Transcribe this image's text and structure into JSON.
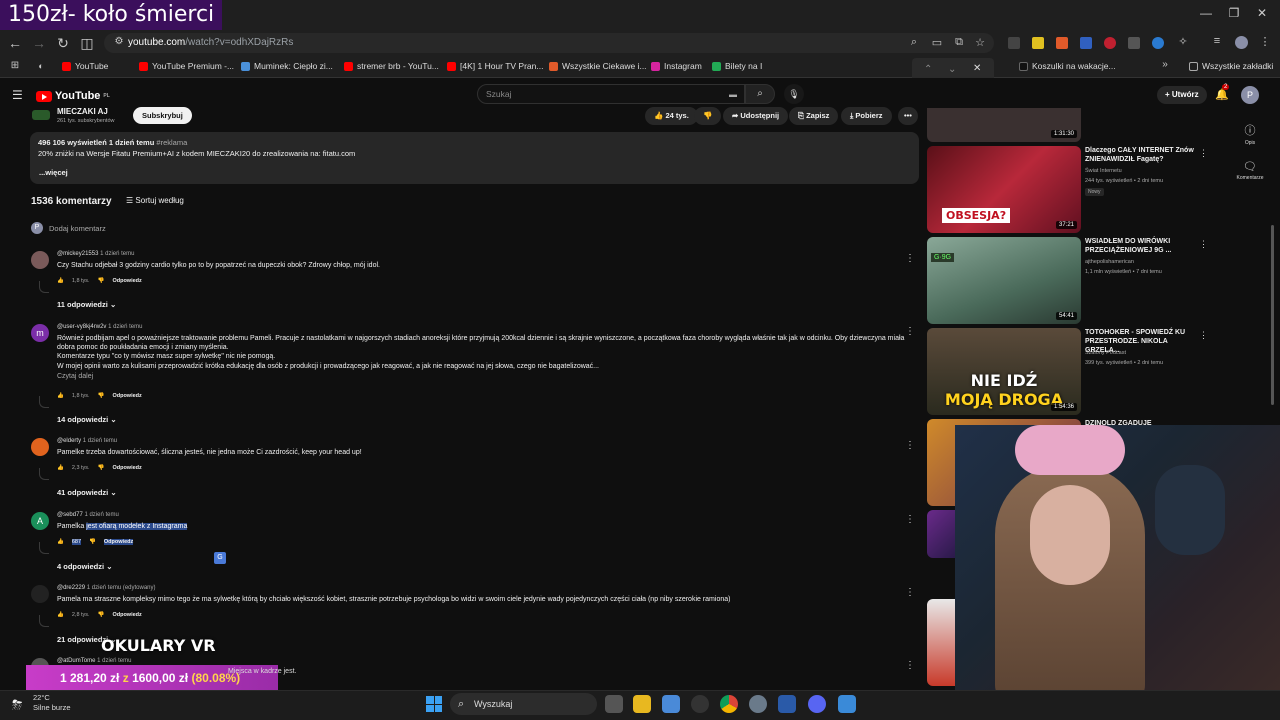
{
  "overlay": {
    "title": "150zł- koło śmierci",
    "vr_label": "OKULARY VR",
    "donation_current": "1 281,20 zł",
    "donation_of": "z",
    "donation_goal": "1600,00 zł",
    "donation_percent": "(80.08%)",
    "ticker": "Miejsca w kadrze jest."
  },
  "browser": {
    "url_host": "youtube.com",
    "url_path": "/watch?v=odhXDajRzRs",
    "bookmarks": [
      {
        "label": "YouTube",
        "color": "#ff0000"
      },
      {
        "label": "YouTube Premium -...",
        "color": "#ff0000"
      },
      {
        "label": "Muminek: Ciepło zi...",
        "color": "#4a90d9"
      },
      {
        "label": "stremer brb - YouTu...",
        "color": "#ff0000"
      },
      {
        "label": "[4K] 1 Hour TV Pran...",
        "color": "#ff0000"
      },
      {
        "label": "Wszystkie Ciekawe i...",
        "color": "#e05a2a"
      },
      {
        "label": "Instagram",
        "color": "#d6249f"
      },
      {
        "label": "Bilety na I",
        "color": "#22aa55"
      },
      {
        "label": "Koszulki na wakacje...",
        "color": "#111111"
      }
    ],
    "all_bookmarks": "Wszystkie zakładki"
  },
  "youtube": {
    "logo": "YouTube",
    "logo_region": "PL",
    "search_placeholder": "Szukaj",
    "create_label": "Utwórz",
    "notif_count": "2",
    "avatar_letter": "P",
    "channel": {
      "name": "MIECZAKI AJ",
      "subs": "261 tys. subskrybentów",
      "subscribe_label": "Subskrybuj"
    },
    "actions": {
      "likes": "24 tys.",
      "share": "Udostępnij",
      "save": "Zapisz",
      "download": "Pobierz"
    },
    "description": {
      "stats": "496 106 wyświetleń  1 dzień temu",
      "tag": "#reklama",
      "text": "20% zniżki na Wersje Fitatu Premium+AI z kodem MIECZAKI20 do zrealizowania na: fitatu.com",
      "more": "...więcej"
    },
    "comments_count": "1536 komentarzy",
    "sort_label": "Sortuj według",
    "add_comment": "Dodaj komentarz",
    "reply_label": "Odpowiedz",
    "comments": [
      {
        "author": "@mickey21553",
        "when": "1 dzień temu",
        "text": "Czy Stachu odjebał 3 godziny cardio tylko po to by popatrzeć na dupeczki obok? Zdrowy chłop, mój idol.",
        "likes": "1,8 tys.",
        "replies": "11 odpowiedzi",
        "avatar_color": "#7a5a5a",
        "avatar_letter": ""
      },
      {
        "author": "@user-vy8kj4rw2v",
        "when": "1 dzień temu",
        "text_lines": [
          "Również podbijam apel o poważniejsze traktowanie problemu Pameli. Pracuje z nastolatkami w najgorszych stadiach anoreksji które przyjmują 200kcal dziennie i są skrajnie wyniszczone, a początkowa faza choroby wygląda właśnie tak jak w odcinku. Oby dziewczyna miała",
          "dobra pomoc do poukładania emocji i zmiany myślenia.",
          "Komentarze typu \"co ty mówisz masz super sylwetkę\" nic nie pomogą.",
          "W mojej opinii warto za kulisami przeprowadzić krótka edukację dla osób z produkcji i prowadzącego jak reagować, a jak nie reagować na jej słowa, czego nie bagatelizować..."
        ],
        "read_more": "Czytaj dalej",
        "likes": "1,8 tys.",
        "replies": "14 odpowiedzi",
        "avatar_color": "#7b2ea8",
        "avatar_letter": "m"
      },
      {
        "author": "@elderty",
        "when": "1 dzień temu",
        "text": "Pamelke trzeba dowartościować, śliczna jesteś, nie jedna może Ci zazdrościć, keep your head up!",
        "likes": "2,3 tys.",
        "replies": "41 odpowiedzi",
        "avatar_color": "#e0631e",
        "avatar_letter": ""
      },
      {
        "author": "@sebd77",
        "when": "1 dzień temu",
        "text_plain": "Pamelka ",
        "text_highlight": "jest ofiarą modelek z Instagrama",
        "likes": "687",
        "replies": "4 odpowiedzi",
        "avatar_color": "#1a8f5a",
        "avatar_letter": "A"
      },
      {
        "author": "@dre2229",
        "when": "1 dzień temu (edytowany)",
        "text": "Pamela ma straszne kompleksy mimo tego że ma sylwetkę którą by chciało większość kobiet, strasznie potrzebuje psychologa bo widzi w swoim ciele jedynie wady pojedynczych części ciała (np niby szerokie ramiona)",
        "likes": "2,8 tys.",
        "replies": "21 odpowiedzi",
        "avatar_color": "#222222",
        "avatar_letter": ""
      },
      {
        "author": "@atDumTome",
        "when": "1 dzień temu",
        "avatar_color": "#555555",
        "avatar_letter": ""
      }
    ],
    "recommendations": [
      {
        "title": "",
        "channel": "",
        "views": "",
        "duration": "1:31:30",
        "thumb_color": "#3a3030"
      },
      {
        "title": "Dlaczego CAŁY INTERNET Znów ZNIENAWIDZIŁ Fagatę?",
        "channel": "Świat Internetu",
        "views": "244 tys. wyświetleń • 2 dni temu",
        "badge": "Nowy",
        "duration": "37:21",
        "thumb_text": "OBSESJA?",
        "thumb_color": "#7a1e28"
      },
      {
        "title": "WSIADŁEM DO WIRÓWKI PRZECIĄŻENIOWEJ 9G ...",
        "channel": "ajthepolishamerican",
        "views": "1,1 mln wyświetleń • 7 dni temu",
        "duration": "54:41",
        "thumb_color": "#5a7a6a"
      },
      {
        "title": "TOTOHOKER - SPOWIEDŹ KU PRZESTRODZE. NIKOLA GRZELA...",
        "channel": "Szalony Podcast",
        "views": "399 tys. wyświetleń • 2 dni temu",
        "duration": "1:54:36",
        "thumb_text1": "NIE IDŹ",
        "thumb_text2": "MOJĄ DROGĄ",
        "thumb_color": "#3a3a2a"
      },
      {
        "title": "DZINOLD ZGADUJE",
        "thumb_color": "#6a4a2a"
      }
    ],
    "rail": [
      {
        "label": "Opis",
        "icon": "info-icon"
      },
      {
        "label": "Komentarze",
        "icon": "comments-icon"
      }
    ]
  },
  "taskbar": {
    "temp": "22°C",
    "weather": "Silne burze",
    "search_label": "Wyszukaj"
  }
}
